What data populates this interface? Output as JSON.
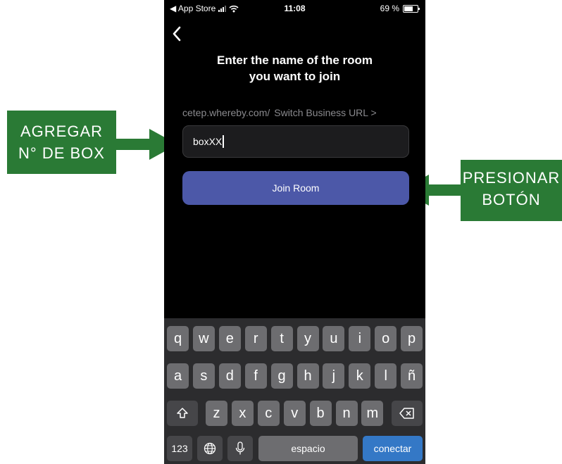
{
  "status_bar": {
    "back_app": "◀ App Store",
    "time": "11:08",
    "battery": "69 %",
    "battery_level": 0.69
  },
  "screen": {
    "title_line1": "Enter the name of the room",
    "title_line2": "you want to join",
    "url_prefix": "cetep.whereby.com/",
    "switch_link": "Switch Business URL >",
    "room_input_value": "boxXX",
    "join_button": "Join Room"
  },
  "keyboard": {
    "row1": [
      "q",
      "w",
      "e",
      "r",
      "t",
      "y",
      "u",
      "i",
      "o",
      "p"
    ],
    "row2": [
      "a",
      "s",
      "d",
      "f",
      "g",
      "h",
      "j",
      "k",
      "l",
      "ñ"
    ],
    "row3": [
      "z",
      "x",
      "c",
      "v",
      "b",
      "n",
      "m"
    ],
    "numbers_key": "123",
    "space_key": "espacio",
    "return_key": "conectar"
  },
  "callouts": {
    "left_line1": "AGREGAR",
    "left_line2": "N° DE BOX",
    "right_line1": "PRESIONAR",
    "right_line2": "BOTÓN"
  },
  "colors": {
    "callout_green": "#2a7a35",
    "join_button": "#4c58a8",
    "return_key": "#3478c6"
  }
}
